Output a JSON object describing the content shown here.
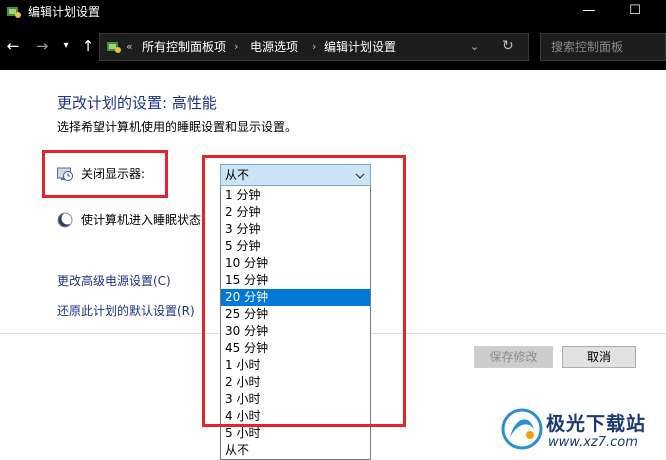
{
  "window": {
    "title": "编辑计划设置",
    "minimize_glyph": "—",
    "maximize_glyph": "☐"
  },
  "nav": {
    "breadcrumb_overflow": "«",
    "breadcrumbs": [
      "所有控制面板项",
      "电源选项",
      "编辑计划设置"
    ],
    "breadcrumb_separator": "›",
    "search_placeholder": "搜索控制面板"
  },
  "content": {
    "heading": "更改计划的设置: 高性能",
    "subtitle": "选择希望计算机使用的睡眠设置和显示设置。",
    "settings": {
      "display_label": "关闭显示器:",
      "display_value": "从不",
      "sleep_label": "使计算机进入睡眠状态"
    },
    "links": {
      "advanced": "更改高级电源设置(C)",
      "restore": "还原此计划的默认设置(R)"
    },
    "buttons": {
      "save": "保存修改",
      "cancel": "取消"
    }
  },
  "dropdown": {
    "selected": "20 分钟",
    "options": [
      "1 分钟",
      "2 分钟",
      "3 分钟",
      "5 分钟",
      "10 分钟",
      "15 分钟",
      "20 分钟",
      "25 分钟",
      "30 分钟",
      "45 分钟",
      "1 小时",
      "2 小时",
      "3 小时",
      "4 小时",
      "5 小时",
      "从不"
    ]
  },
  "watermark": {
    "name": "极光下载站",
    "url": "www.xz7.com"
  },
  "colors": {
    "link": "#1e3287",
    "selection": "#0078d7",
    "annotation": "#e4242a",
    "titlebar": "#000000"
  }
}
